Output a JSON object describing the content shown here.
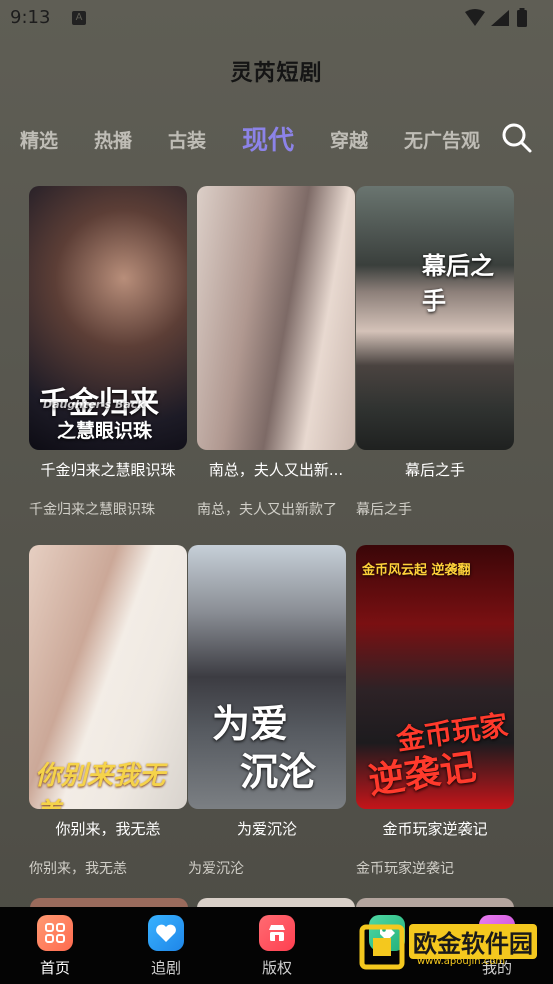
{
  "status": {
    "time": "9:13",
    "a_icon": "A"
  },
  "header": {
    "title": "灵芮短剧"
  },
  "tabs": [
    {
      "label": "精选"
    },
    {
      "label": "热播"
    },
    {
      "label": "古装"
    },
    {
      "label": "现代"
    },
    {
      "label": "穿越"
    },
    {
      "label": "无广告观"
    }
  ],
  "active_tab": "现代",
  "rows": [
    [
      {
        "title": "千金归来之慧眼识珠",
        "subtitle": "千金归来之慧眼识珠",
        "poster_text_1": "千金归来",
        "poster_text_2": "之慧眼识珠",
        "poster_text_3": "Daughter's Back"
      },
      {
        "title": "南总，夫人又出新...",
        "subtitle": "南总，夫人又出新款了"
      },
      {
        "title": "幕后之手",
        "subtitle": "幕后之手",
        "poster_text_1": "幕后之手"
      }
    ],
    [
      {
        "title": "你别来，我无恙",
        "subtitle": "你别来，我无恙",
        "poster_text_1": "你别来我无恙"
      },
      {
        "title": "为爱沉沦",
        "subtitle": "为爱沉沦",
        "poster_text_1": "为爱",
        "poster_text_2": "沉沦"
      },
      {
        "title": "金币玩家逆袭记",
        "subtitle": "金币玩家逆袭记",
        "poster_text_1": "金币玩家",
        "poster_text_2": "逆袭记",
        "poster_text_3": "金币风云起 逆袭翻"
      }
    ]
  ],
  "nav": [
    {
      "label": "首页",
      "icon": "home-grid-icon",
      "color": "#ff7a5c"
    },
    {
      "label": "追剧",
      "icon": "heart-icon",
      "color": "#2b9bf0"
    },
    {
      "label": "版权",
      "icon": "shop-icon",
      "color": "#ff5560"
    },
    {
      "label": "",
      "icon": "tag-icon",
      "color": "#2bbf86"
    },
    {
      "label": "我的",
      "icon": "home-icon",
      "color": "#d75ee0"
    }
  ],
  "watermark": {
    "text": "欧金软件园",
    "url": "www.apoujin.com"
  },
  "colors": {
    "accent": "#8c83e8"
  }
}
